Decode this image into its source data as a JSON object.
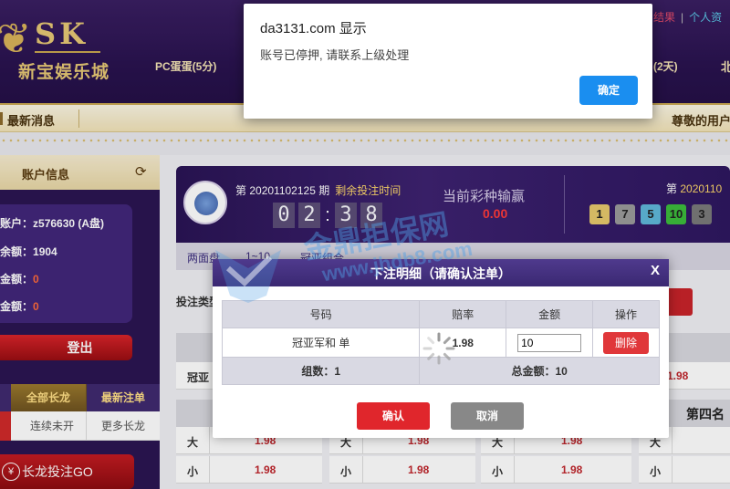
{
  "header": {
    "logo_letters": "SK",
    "logo_name": "新宝娱乐城",
    "nav_pc": "PC蛋蛋(5分)",
    "nav_2d": "(2天)",
    "nav_b": "北",
    "top_link_a": "结果",
    "top_link_b": "个人资"
  },
  "newsbar": {
    "label": "最新消息",
    "greeting": "尊敬的用户"
  },
  "account": {
    "title": "账户信息",
    "account_label": "账户：",
    "account_value": "z576630 (A盘)",
    "balance_label": "余额：",
    "balance_value": "1904",
    "amount1_label": "金额：",
    "amount1_value": "0",
    "amount2_label": "金额：",
    "amount2_value": "0",
    "logout": "登出"
  },
  "dragon": {
    "tab_all": "全部长龙",
    "tab_latest": "最新注单",
    "sub_a": "连续未开",
    "sub_b": "更多长龙",
    "go_button": "长龙投注GO",
    "yen": "¥"
  },
  "draw": {
    "period_prefix": "第",
    "period": "20201102125",
    "period_suffix": "期",
    "remaining_label": "剩余投注时间",
    "countdown": [
      "0",
      "2",
      "3",
      "8"
    ],
    "profit_label": "当前彩种输赢",
    "profit_value": "0.00",
    "last_period_prefix": "第",
    "last_period": "2020110",
    "balls": [
      {
        "n": "1",
        "color": "#e6c96c"
      },
      {
        "n": "7",
        "color": "#9b9b9b"
      },
      {
        "n": "5",
        "color": "#5fb8d9"
      },
      {
        "n": "10",
        "color": "#3cbd3c"
      },
      {
        "n": "3",
        "color": "#7a7a7a"
      }
    ]
  },
  "subtabs": [
    "两面盘",
    "1~10",
    "冠亚组合"
  ],
  "bet_type_label": "投注类型",
  "grid": {
    "row1_label": "冠亚",
    "row1_odds": "1.98",
    "fourth_header": "第四名",
    "rows": [
      {
        "k": "大",
        "v": "1.98"
      },
      {
        "k": "小",
        "v": "1.98"
      }
    ]
  },
  "watermark": {
    "text": "金鼎担保网",
    "url": "www.jhdb8.com"
  },
  "modal": {
    "title": "下注明细（请确认注单）",
    "close": "X",
    "col_number": "号码",
    "col_odds": "赔率",
    "col_amount": "金额",
    "col_action": "操作",
    "row_number": "冠亚军和 单",
    "row_odds": "1.98",
    "row_amount": "10",
    "row_delete": "删除",
    "count_label": "组数：1",
    "total_label": "总金额：10",
    "confirm": "确认",
    "cancel": "取消"
  },
  "alert": {
    "title": "da3131.com 显示",
    "message": "账号已停押, 请联系上级处理",
    "ok": "确定"
  }
}
